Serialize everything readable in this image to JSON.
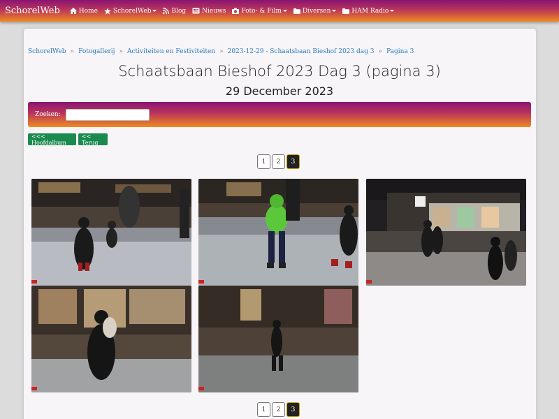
{
  "nav": {
    "brand": "SchorelWeb",
    "items": [
      {
        "label": "Home",
        "icon": "home-icon",
        "dropdown": false
      },
      {
        "label": "SchorelWeb",
        "icon": "star-icon",
        "dropdown": true
      },
      {
        "label": "Blog",
        "icon": "rss-icon",
        "dropdown": false
      },
      {
        "label": "Nieuws",
        "icon": "newspaper-icon",
        "dropdown": false
      },
      {
        "label": "Foto- & Film",
        "icon": "camera-icon",
        "dropdown": true
      },
      {
        "label": "Diversen",
        "icon": "folder-icon",
        "dropdown": true
      },
      {
        "label": "HAM Radio",
        "icon": "folder-icon",
        "dropdown": true
      }
    ]
  },
  "breadcrumb": [
    "SchorelWeb",
    "Fotogallerij",
    "Activiteiten en Festiviteiten",
    "2023-12-29 - Schaatsbaan Bieshof 2023 dag 3",
    "Pagina 3"
  ],
  "page": {
    "title": "Schaatsbaan Bieshof 2023 Dag 3 (pagina 3)",
    "date": "29 December 2023"
  },
  "search": {
    "label": "Zoeken:",
    "value": ""
  },
  "buttons": {
    "main_album": "<<< Hoofdalbum",
    "back": "<< Terug"
  },
  "pagination": {
    "pages": [
      "1",
      "2",
      "3"
    ],
    "current": "3"
  },
  "photos_count_visible": 5,
  "colors": {
    "gradient_top": "#8a1473",
    "gradient_bottom": "#f08a1e",
    "button_green": "#1a8a4e"
  }
}
